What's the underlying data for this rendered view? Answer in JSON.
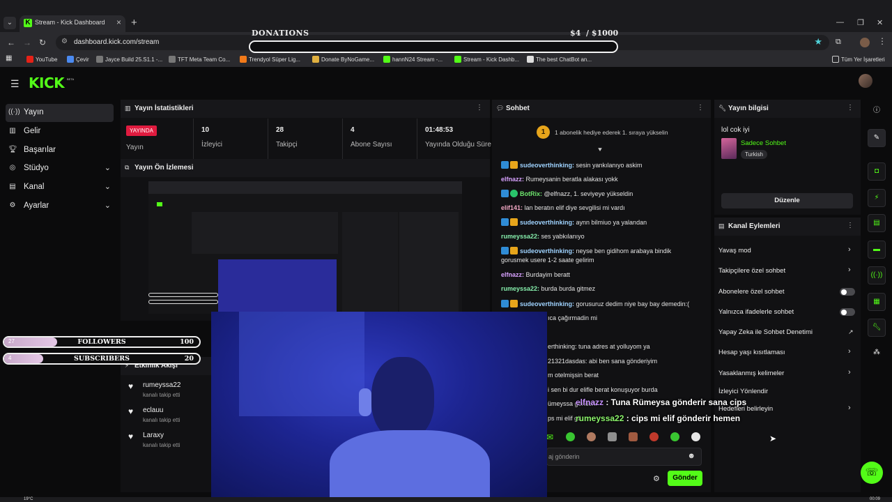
{
  "browser": {
    "tab_title": "Stream - Kick Dashboard",
    "url": "dashboard.kick.com/stream",
    "bookmarks": [
      "YouTube",
      "Çevir",
      "Jayce Build 25.S1.1 -...",
      "TFT Meta Team Co...",
      "Trendyol Süper Lig...",
      "Donate ByNoGame...",
      "hannN24 Stream -...",
      "Stream - Kick Dashb...",
      "The best ChatBot an..."
    ],
    "bookmark_folder": "Tüm Yer İşaretleri"
  },
  "donations": {
    "title": "DONATIONS",
    "current": "$4",
    "separator": "/",
    "goal": "$1000"
  },
  "nav": {
    "items": [
      {
        "label": "Yayın",
        "icon": "broadcast-icon"
      },
      {
        "label": "Gelir",
        "icon": "revenue-icon"
      },
      {
        "label": "Başarılar",
        "icon": "trophy-icon"
      },
      {
        "label": "Stüdyo",
        "icon": "studio-icon"
      },
      {
        "label": "Kanal",
        "icon": "channel-icon"
      },
      {
        "label": "Ayarlar",
        "icon": "settings-icon"
      }
    ]
  },
  "stats": {
    "title": "Yayın İstatistikleri",
    "live_badge": "YAYINDA",
    "live_label": "Yayın",
    "items": [
      {
        "value": "10",
        "label": "İzleyici"
      },
      {
        "value": "28",
        "label": "Takipçi"
      },
      {
        "value": "4",
        "label": "Abone Sayısı"
      },
      {
        "value": "01:48:53",
        "label": "Yayında Olduğu Süre"
      }
    ]
  },
  "preview": {
    "title": "Yayın Ön İzlemesi"
  },
  "overlays": {
    "followers": {
      "count": "27",
      "label": "FOLLOWERS",
      "goal": "100",
      "fill": 0.27
    },
    "subscribers": {
      "count": "4",
      "label": "SUBSCRIBERS",
      "goal": "20",
      "fill": 0.2
    }
  },
  "activity": {
    "title": "Etkinlik Akışı",
    "items": [
      {
        "name": "rumeyssa22",
        "action": "kanalı takip etti"
      },
      {
        "name": "eclauu",
        "action": "kanalı takip etti"
      },
      {
        "name": "Laraxy",
        "action": "kanalı takip etti"
      }
    ]
  },
  "chat": {
    "title": "Sohbet",
    "pinned_rank": "1",
    "pinned_text": "1 abonelik hediye ederek 1. sıraya yükselin",
    "messages": [
      {
        "user": "sudeoverthinking:",
        "text": " sesin yankılanıyo askim"
      },
      {
        "user": "elfnazz:",
        "text": " Rumeysanin beratla alakası yokk"
      },
      {
        "user": "BotRix:",
        "text": " @elfnazz, 1. seviyeye yükseldin"
      },
      {
        "user": "elif141:",
        "text": " lan beratın elif diye sevgilisi mi vardı"
      },
      {
        "user": "sudeoverthinking:",
        "text": " aynn bilmiuo ya yalandan"
      },
      {
        "user": "rumeyssa22:",
        "text": " ses yabkılanıyo"
      },
      {
        "user": "sudeoverthinking:",
        "text": " neyse ben gidihom arabaya bindik gorusmek usere 1-2 saate gelirim"
      },
      {
        "user": "elfnazz:",
        "text": " Burdayim beratt"
      },
      {
        "user": "rumeyssa22:",
        "text": " burda burda gitmez"
      },
      {
        "user": "sudeoverthinking:",
        "text": " gorusuruz dedim niye bay bay demedin:("
      }
    ],
    "partial": [
      "ıca çağırmadin mi",
      "erthinking: tuna adres at yolluyom ya",
      "21321dasdas: abi ben sana gönderiyim",
      "m otelmişsin berat",
      "i sen bi dur elifle berat konuşuyor burda",
      "ümeyssa gönderir",
      "ps mi elif gö"
    ],
    "input_placeholder": "aj gönderin",
    "send_label": "Gönder"
  },
  "overlay_chat": [
    {
      "user": "elfnazz",
      "text": " : Tuna Rümeysa gönderir sana cips"
    },
    {
      "user": "rumeyssa22",
      "text": " : cips mi elif gönderir hemen"
    }
  ],
  "stream_info": {
    "title": "Yayın bilgisi",
    "stream_title": "lol cok iyi",
    "category": "Sadece Sohbet",
    "language": "Turkish",
    "edit_label": "Düzenle"
  },
  "channel_actions": {
    "title": "Kanal Eylemleri",
    "items": [
      {
        "label": "Yavaş mod",
        "control": "chevron"
      },
      {
        "label": "Takipçilere özel sohbet",
        "control": "chevron"
      },
      {
        "label": "Abonelere özel sohbet",
        "control": "toggle"
      },
      {
        "label": "Yalnızca ifadelerle sohbet",
        "control": "toggle"
      },
      {
        "label": "Yapay Zeka ile Sohbet Denetimi",
        "control": "external"
      },
      {
        "label": "Hesap yaşı kısıtlaması",
        "control": "chevron"
      },
      {
        "label": "Yasaklanmış kelimeler",
        "control": "chevron"
      },
      {
        "label": "İzleyici Yönlendir",
        "control": "none"
      },
      {
        "label": "Hedefleri belirleyin",
        "control": "chevron"
      }
    ]
  },
  "taskbar": {
    "temperature": "19°C",
    "time": "00:09"
  },
  "colors": {
    "accent": "#53fc18",
    "live": "#e01b3f",
    "panel": "#111113"
  }
}
